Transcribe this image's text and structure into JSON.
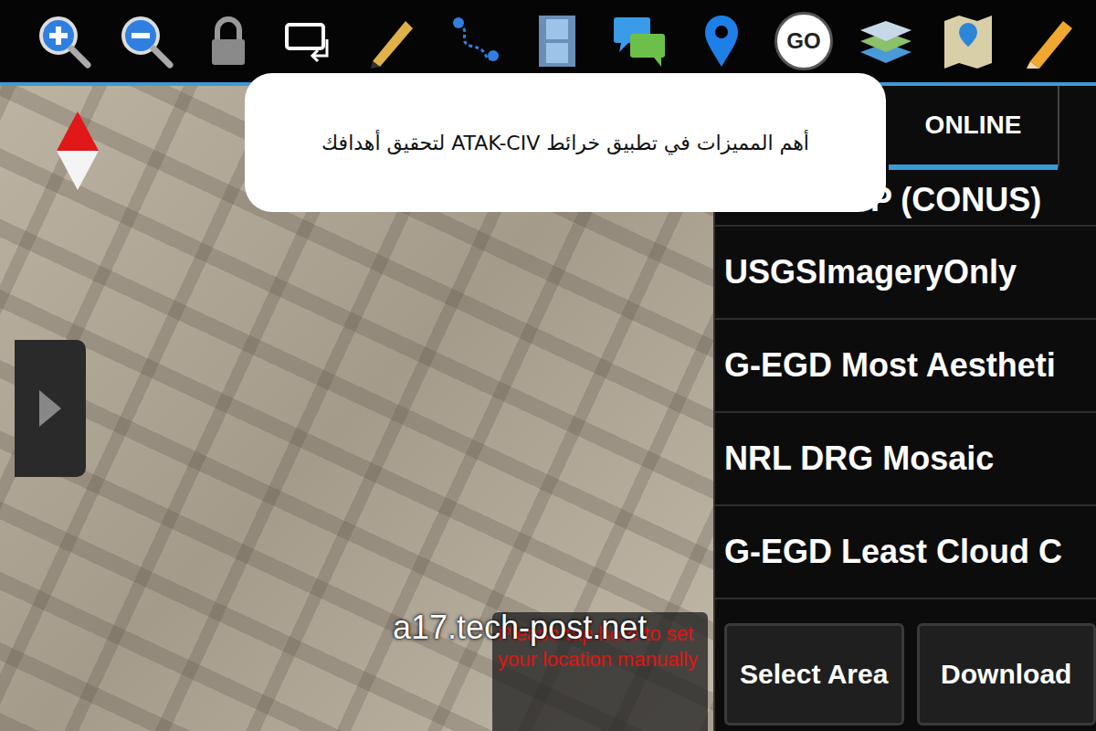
{
  "toolbar": {
    "go_label": "GO"
  },
  "title_card": {
    "text": "أهم المميزات في تطبيق خرائط ATAK-CIV لتحقيق أهدافك"
  },
  "tabs": [
    {
      "label": "ONLINE",
      "selected": true
    }
  ],
  "layers": [
    {
      "name": "P (CONUS)",
      "kind": "partial"
    },
    {
      "name": "USGSImageryOnly",
      "kind": "full"
    },
    {
      "name": "G-EGD Most Aestheti",
      "kind": "full"
    },
    {
      "name": "NRL DRG Mosaic",
      "kind": "full"
    },
    {
      "name": "G-EGD Least Cloud C",
      "kind": "full"
    }
  ],
  "buttons": [
    "Select Area",
    "Download"
  ],
  "location_notice": "Please tap here to set your location manually",
  "watermark": "a17.tech-post.net"
}
